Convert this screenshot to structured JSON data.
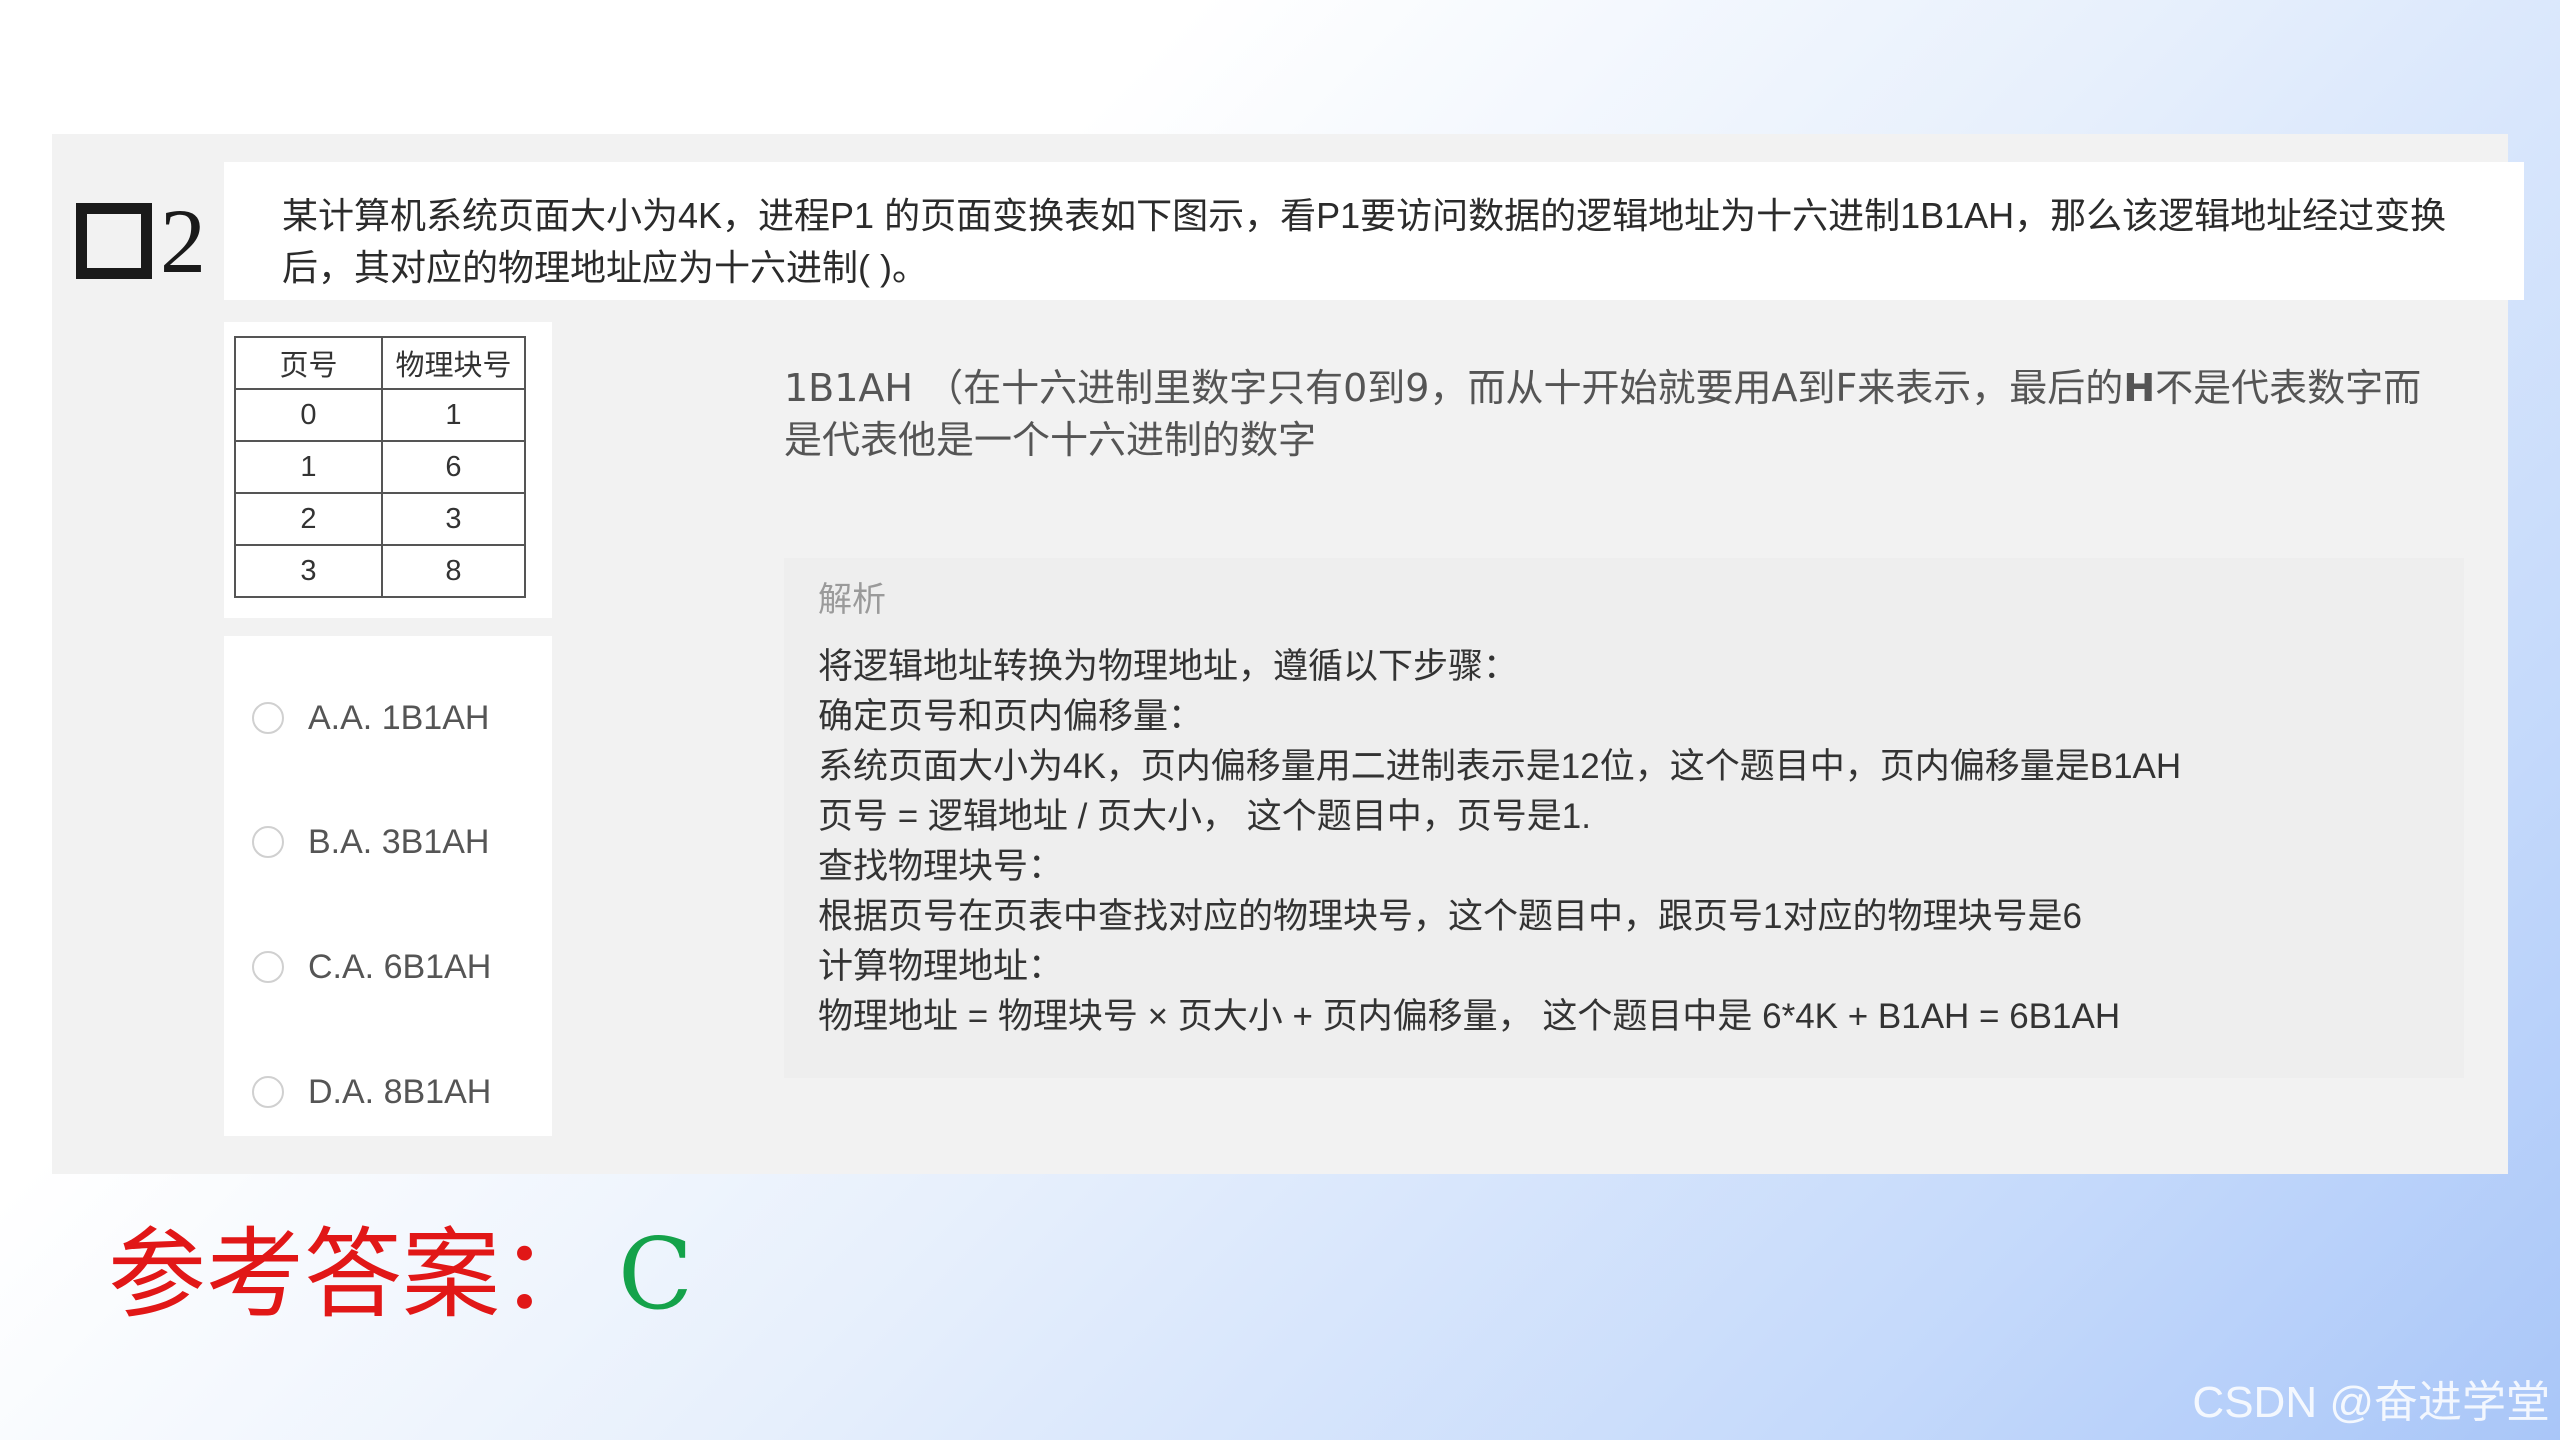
{
  "question": {
    "number": "2",
    "text": "某计算机系统页面大小为4K，进程P1 的页面变换表如下图示，看P1要访问数据的逻辑地址为十六进制1B1AH，那么该逻辑地址经过变换后，其对应的物理地址应为十六进制(    )。"
  },
  "page_table": {
    "headers": [
      "页号",
      "物理块号"
    ],
    "rows": [
      [
        "0",
        "1"
      ],
      [
        "1",
        "6"
      ],
      [
        "2",
        "3"
      ],
      [
        "3",
        "8"
      ]
    ]
  },
  "options": [
    "A.A. 1B1AH",
    "B.A. 3B1AH",
    "C.A. 6B1AH",
    "D.A. 8B1AH"
  ],
  "explanation": {
    "prefix": "1B1AH",
    "part1": "（在十六进制里数字只有0到9，而从十开始就要用A到F来表示，最后的",
    "bold": "H",
    "part2": "不是代表数字而是代表他是一个十六进制的数字"
  },
  "analysis": {
    "title": "解析",
    "lines": [
      "将逻辑地址转换为物理地址，遵循以下步骤：",
      "确定页号和页内偏移量：",
      "系统页面大小为4K，页内偏移量用二进制表示是12位，这个题目中，页内偏移量是B1AH",
      "页号 = 逻辑地址 / 页大小，  这个题目中，页号是1.",
      "查找物理块号：",
      "根据页号在页表中查找对应的物理块号，这个题目中，跟页号1对应的物理块号是6",
      "计算物理地址：",
      "物理地址 = 物理块号 × 页大小 + 页内偏移量，  这个题目中是 6*4K + B1AH = 6B1AH"
    ]
  },
  "answer": {
    "label": "参考答案：",
    "value": "C"
  },
  "watermark": "CSDN @奋进学堂",
  "colors": {
    "answer_label": "#e11717",
    "answer_value": "#14a24a"
  }
}
